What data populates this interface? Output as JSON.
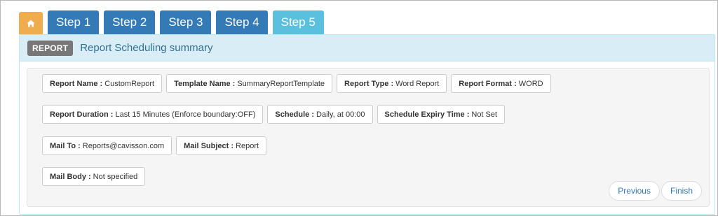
{
  "colors": {
    "home_tab": "#f0ad4e",
    "step_tab": "#337ab7",
    "current_tab": "#5bc0de",
    "panel_heading_bg": "#d9edf7",
    "panel_title": "#31708f",
    "badge_bg": "#777777",
    "link": "#337ab7"
  },
  "tabs": {
    "home_icon": "home-icon",
    "steps": [
      {
        "label": "Step 1",
        "state": "complete"
      },
      {
        "label": "Step 2",
        "state": "complete"
      },
      {
        "label": "Step 3",
        "state": "complete"
      },
      {
        "label": "Step 4",
        "state": "complete"
      },
      {
        "label": "Step 5",
        "state": "current"
      }
    ]
  },
  "panel": {
    "badge": "REPORT",
    "title": "Report Scheduling summary"
  },
  "summary": {
    "report_name": {
      "label": "Report Name :",
      "value": "CustomReport"
    },
    "template_name": {
      "label": "Template Name :",
      "value": "SummaryReportTemplate"
    },
    "report_type": {
      "label": "Report Type :",
      "value": "Word Report"
    },
    "report_format": {
      "label": "Report Format :",
      "value": "WORD"
    },
    "report_duration": {
      "label": "Report Duration :",
      "value": "Last 15 Minutes (Enforce boundary:OFF)"
    },
    "schedule": {
      "label": "Schedule :",
      "value": "Daily, at 00:00"
    },
    "schedule_expiry": {
      "label": "Schedule Expiry Time :",
      "value": "Not Set"
    },
    "mail_to": {
      "label": "Mail To :",
      "value": "Reports@cavisson.com"
    },
    "mail_subject": {
      "label": "Mail Subject :",
      "value": "Report"
    },
    "mail_body": {
      "label": "Mail Body :",
      "value": "Not specified"
    }
  },
  "nav": {
    "previous": "Previous",
    "finish": "Finish"
  }
}
